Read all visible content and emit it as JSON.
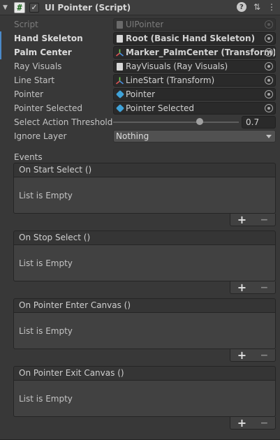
{
  "component": {
    "title": "UI Pointer (Script)",
    "script_icon_glyph": "#",
    "enabled_glyph": "✓",
    "foldout_glyph": "▼",
    "menu_glyph": "⋮",
    "preset_glyph": "⇅",
    "help_glyph": "?"
  },
  "properties": {
    "script": {
      "label": "Script",
      "value": "UIPointer",
      "icon": "script-doc-icon"
    },
    "hand_skeleton": {
      "label": "Hand Skeleton",
      "value": "Root (Basic Hand Skeleton)",
      "icon": "doc-icon"
    },
    "palm_center": {
      "label": "Palm Center",
      "value": "Marker_PalmCenter (Transform)",
      "icon": "transform-axis-icon"
    },
    "ray_visuals": {
      "label": "Ray Visuals",
      "value": "RayVisuals (Ray Visuals)",
      "icon": "doc-icon"
    },
    "line_start": {
      "label": "Line Start",
      "value": "LineStart (Transform)",
      "icon": "transform-axis-icon"
    },
    "pointer": {
      "label": "Pointer",
      "value": "Pointer",
      "icon": "prefab-cube-icon"
    },
    "pointer_selected": {
      "label": "Pointer Selected",
      "value": "Pointer Selected",
      "icon": "prefab-cube-icon"
    },
    "select_action_threshold": {
      "label": "Select Action Threshold",
      "value": "0.7",
      "fraction": 0.7
    },
    "ignore_layer": {
      "label": "Ignore Layer",
      "value": "Nothing"
    }
  },
  "events": {
    "label": "Events",
    "items": [
      {
        "name": "On Start Select ()",
        "empty_text": "List is Empty",
        "plus": "+",
        "minus": "−"
      },
      {
        "name": "On Stop Select ()",
        "empty_text": "List is Empty",
        "plus": "+",
        "minus": "−"
      },
      {
        "name": "On Pointer Enter Canvas ()",
        "empty_text": "List is Empty",
        "plus": "+",
        "minus": "−"
      },
      {
        "name": "On Pointer Exit Canvas ()",
        "empty_text": "List is Empty",
        "plus": "+",
        "minus": "−"
      }
    ]
  },
  "colors": {
    "background": "#383838",
    "modified_indicator": "#4b8ac9",
    "prefab_blue": "#3fa2d8"
  }
}
